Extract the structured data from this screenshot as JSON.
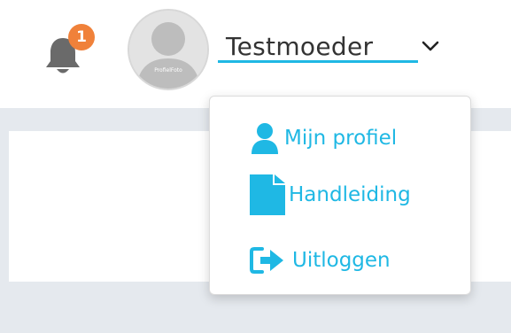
{
  "header": {
    "notification_count": "1",
    "avatar_caption": "ProfielFoto",
    "username": "Testmoeder"
  },
  "user_menu": {
    "items": [
      {
        "label": "Mijn profiel",
        "icon": "user-icon"
      },
      {
        "label": "Handleiding",
        "icon": "document-icon"
      },
      {
        "label": "Uitloggen",
        "icon": "logout-icon"
      }
    ]
  },
  "colors": {
    "accent": "#1fb8e4",
    "badge": "#f0813a",
    "bell": "#6a6a6a",
    "text": "#333333",
    "page_background": "#e5e9ee"
  }
}
